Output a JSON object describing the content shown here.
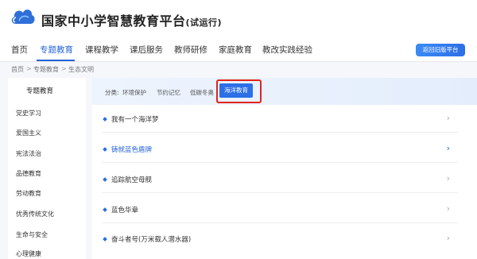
{
  "header": {
    "title": "国家中小学智慧教育平台",
    "subtitle": "(试运行)"
  },
  "nav": {
    "items": [
      "首页",
      "专题教育",
      "课程教学",
      "课后服务",
      "教师研修",
      "家庭教育",
      "教改实践经验"
    ],
    "active_index": 1,
    "back_button": "返回旧版平台"
  },
  "breadcrumb": [
    "首页",
    "专题教育",
    "生态文明"
  ],
  "sidebar": {
    "title": "专题教育",
    "items": [
      "党史学习",
      "爱国主义",
      "宪法法治",
      "品德教育",
      "劳动教育",
      "优秀传统文化",
      "生命与安全",
      "心理健康"
    ]
  },
  "filter": {
    "label": "分类:",
    "items": [
      "环境保护",
      "节约记忆",
      "低碳冬奥"
    ],
    "active": "海洋教育"
  },
  "list": [
    {
      "title": "我有一个海洋梦",
      "highlighted": false
    },
    {
      "title": "铸就蓝色盾牌",
      "highlighted": true
    },
    {
      "title": "追踪航空母舰",
      "highlighted": false
    },
    {
      "title": "蓝色华章",
      "highlighted": false
    },
    {
      "title": "奋斗者号(万米载人潜水器)",
      "highlighted": false
    }
  ],
  "colors": {
    "accent": "#2463d8",
    "highlight_border": "#e0241c",
    "active_chip": "#2c6fe6"
  },
  "icons": {
    "logo": "cloud-logo-icon",
    "chevron": "chevron-right-icon",
    "bullet": "diamond-bullet-icon"
  }
}
